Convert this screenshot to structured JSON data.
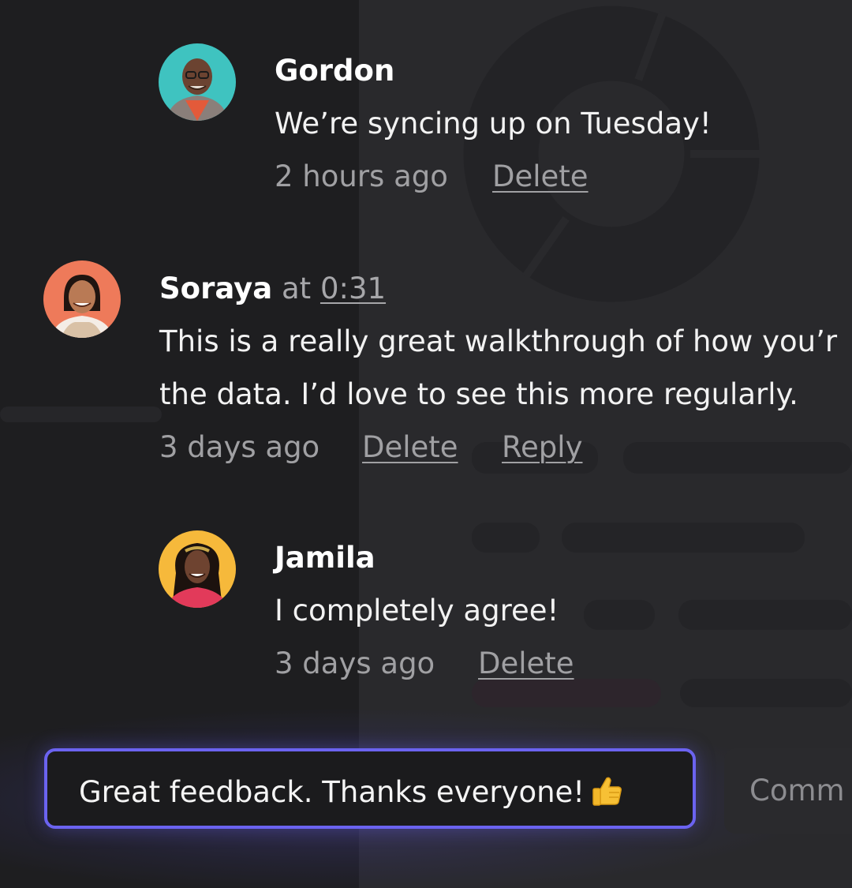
{
  "comments": [
    {
      "author": "Gordon",
      "lines": [
        "We’re syncing up on Tuesday!"
      ],
      "time": "2 hours ago",
      "delete_label": "Delete"
    },
    {
      "author": "Soraya",
      "at_label": "at",
      "timestamp": "0:31",
      "lines": [
        "This is a really great walkthrough of how you’r",
        "the data. I’d love to see this more regularly."
      ],
      "time": "3 days ago",
      "delete_label": "Delete",
      "reply_label": "Reply"
    },
    {
      "author": "Jamila",
      "lines": [
        "I completely agree!"
      ],
      "time": "3 days ago",
      "delete_label": "Delete"
    }
  ],
  "composer": {
    "value": "Great feedback. Thanks everyone!",
    "emoji_icon": "thumbs-up-icon"
  },
  "comment_button": {
    "label": "Comm"
  },
  "colors": {
    "accent": "#6b63f0",
    "background": "#1e1e20",
    "muted_text": "#a0a0a3"
  }
}
